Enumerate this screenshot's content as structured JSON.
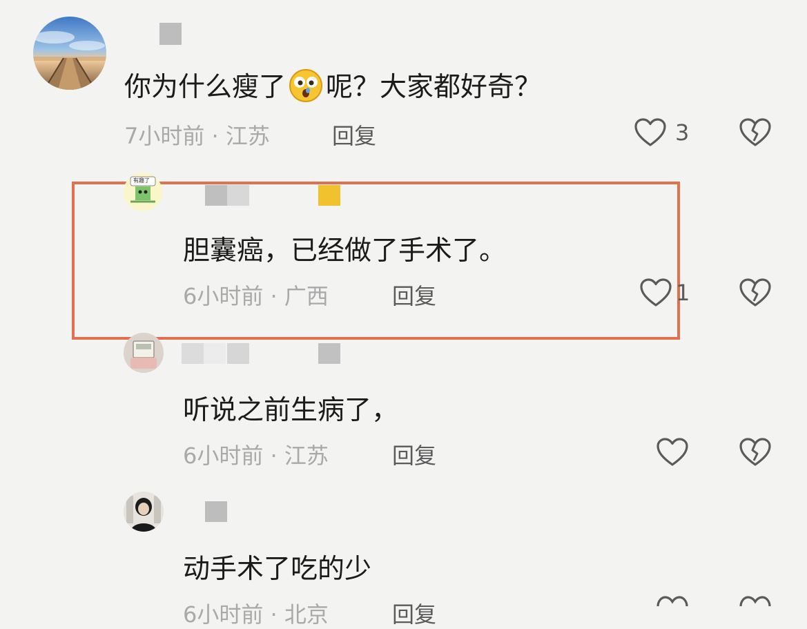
{
  "comments": [
    {
      "text_before": "你为什么瘦了",
      "text_after": "呢？大家都好奇？",
      "emoji": "astonished-face-emoji",
      "meta": "7小时前 · 江苏",
      "reply": "回复",
      "likes": "3"
    },
    {
      "text": "胆囊癌，已经做了手术了。",
      "meta": "6小时前 · 广西",
      "reply": "回复",
      "likes": "1"
    },
    {
      "text": "听说之前生病了，",
      "meta": "6小时前 · 江苏",
      "reply": "回复"
    },
    {
      "text": "动手术了吃的少",
      "meta": "6小时前 · 北京",
      "reply": "回复"
    }
  ],
  "avatar_sticker_text": "有趣了",
  "colors": {
    "background": "#f3f3f2",
    "highlight_border": "#e2704f",
    "text_primary": "#1b1b1b",
    "text_meta": "#a9a9a9",
    "icon": "#5a5a5a",
    "badge_yellow": "#f2c12e"
  }
}
